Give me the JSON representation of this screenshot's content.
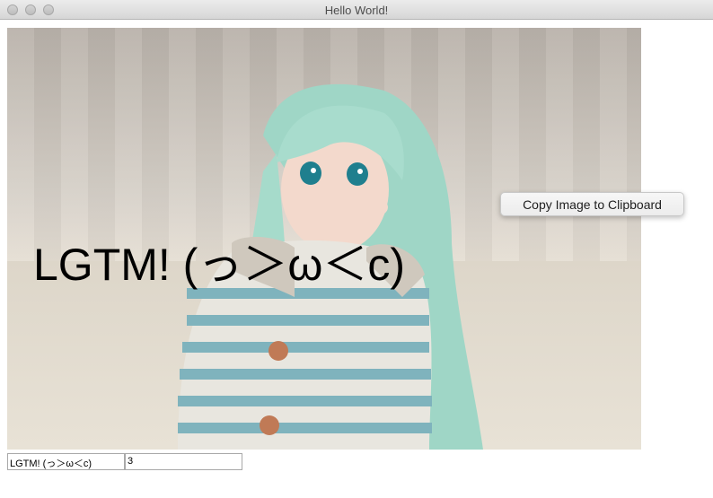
{
  "window": {
    "title": "Hello World!"
  },
  "image": {
    "overlay_text": "LGTM! (っ＞ω＜c)"
  },
  "context_menu": {
    "items": [
      {
        "label": "Copy Image to Clipboard"
      }
    ]
  },
  "inputs": {
    "text_value": "LGTM! (っ＞ω＜c)",
    "number_value": "3"
  }
}
